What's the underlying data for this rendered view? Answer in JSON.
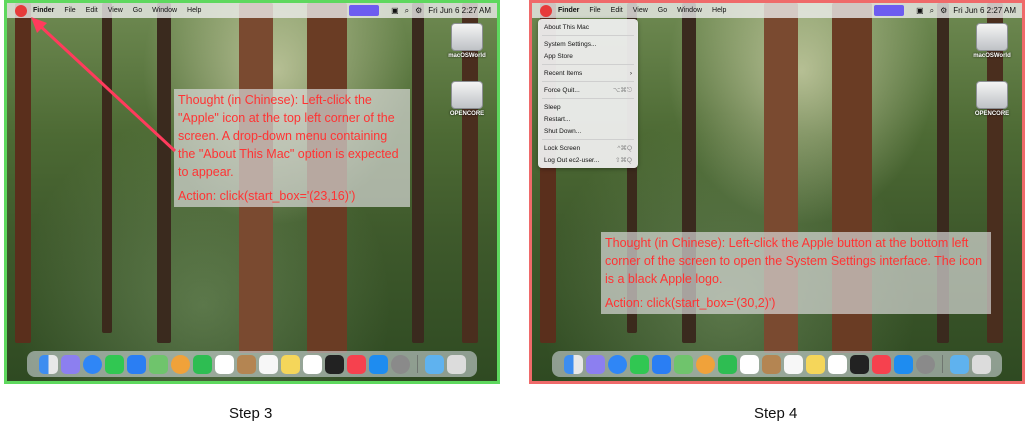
{
  "steps": [
    {
      "label": "Step 3",
      "border_color": "#5ed85e",
      "menubar": {
        "app": "Finder",
        "menus": [
          "File",
          "Edit",
          "View",
          "Go",
          "Window",
          "Help"
        ],
        "clock": "Fri Jun 6  2:27 AM"
      },
      "desktop_icons": [
        "macOSWorld",
        "OPENCORE"
      ],
      "thought": "Thought (in Chinese): Left-click the \"Apple\" icon at the top left corner of the screen. A drop-down menu containing the \"About This Mac\" option is expected to appear.",
      "action": "Action: click(start_box='(23,16)')"
    },
    {
      "label": "Step 4",
      "border_color": "#ef6a6a",
      "menubar": {
        "app": "Finder",
        "menus": [
          "File",
          "Edit",
          "View",
          "Go",
          "Window",
          "Help"
        ],
        "clock": "Fri Jun 6  2:27 AM"
      },
      "desktop_icons": [
        "macOSWorld",
        "OPENCORE"
      ],
      "apple_menu": [
        {
          "label": "About This Mac",
          "shortcut": ""
        },
        {
          "label": "System Settings...",
          "shortcut": ""
        },
        {
          "label": "App Store",
          "shortcut": ""
        },
        {
          "label": "Recent Items",
          "shortcut": "›"
        },
        {
          "label": "Force Quit...",
          "shortcut": "⌥⌘⎋"
        },
        {
          "label": "Sleep",
          "shortcut": ""
        },
        {
          "label": "Restart...",
          "shortcut": ""
        },
        {
          "label": "Shut Down...",
          "shortcut": ""
        },
        {
          "label": "Lock Screen",
          "shortcut": "^⌘Q"
        },
        {
          "label": "Log Out ec2-user...",
          "shortcut": "⇧⌘Q"
        }
      ],
      "thought": "Thought (in Chinese): Left-click the Apple button at the bottom left corner of the screen to open the System Settings interface. The icon is a black Apple logo.",
      "action": "Action: click(start_box='(30,2)')"
    }
  ],
  "colors": {
    "annotation_text": "#ff3333",
    "arrow": "#ff3b5c",
    "recording_indicator": "#6d5cf0"
  },
  "icons": {
    "apple_menu": "apple-icon",
    "menubar_right": [
      "screen-record-icon",
      "search-icon",
      "control-center-icon"
    ],
    "dock": [
      "finder-icon",
      "launchpad-icon",
      "safari-icon",
      "messages-icon",
      "mail-icon",
      "maps-icon",
      "photos-icon",
      "facetime-icon",
      "calendar-icon",
      "contacts-icon",
      "reminders-icon",
      "notes-icon",
      "freeform-icon",
      "tv-icon",
      "music-icon",
      "app-store-icon",
      "system-settings-icon",
      "downloads-folder-icon",
      "trash-icon"
    ]
  }
}
